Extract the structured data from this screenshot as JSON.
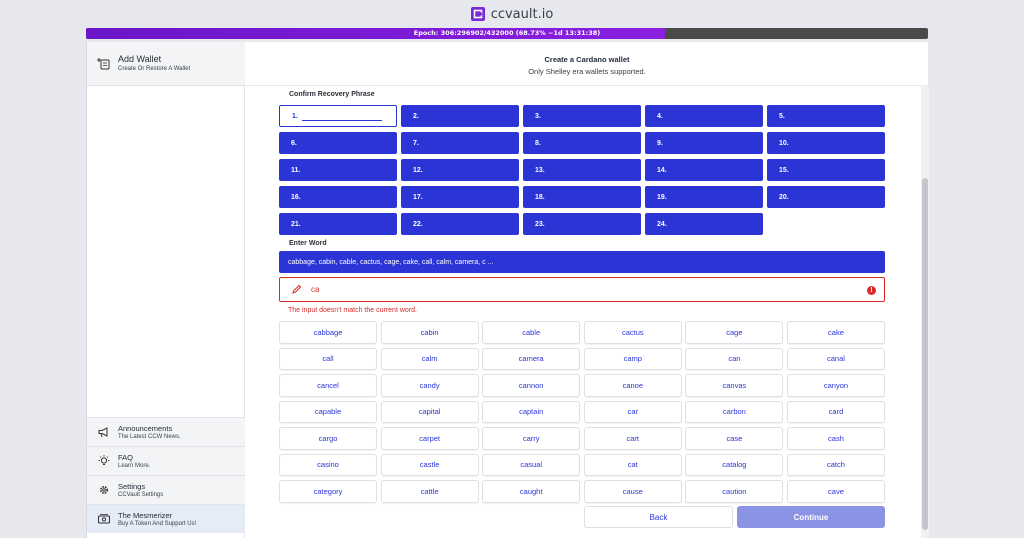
{
  "app": {
    "brand": "ccvault.io",
    "brand_color": "#7a2bd6"
  },
  "epoch": {
    "text": "Epoch: 306:296902/432000 (68.73% ~1d 13:31:38)",
    "progress": 0.6873
  },
  "sidebar": {
    "add_wallet": {
      "title": "Add Wallet",
      "subtitle": "Create Or Restore A Wallet",
      "icon": "add-wallet-icon"
    },
    "items": [
      {
        "title": "Announcements",
        "subtitle": "The Latest CCW News.",
        "icon": "megaphone-icon"
      },
      {
        "title": "FAQ",
        "subtitle": "Learn More.",
        "icon": "lightbulb-icon"
      },
      {
        "title": "Settings",
        "subtitle": "CCVault Settings",
        "icon": "gear-icon"
      },
      {
        "title": "The Mesmerizer",
        "subtitle": "Buy A Token And Support Us!",
        "icon": "money-icon"
      }
    ]
  },
  "header": {
    "title": "Create a Cardano wallet",
    "subtitle": "Only Shelley era wallets supported."
  },
  "recovery": {
    "label": "Confirm Recovery Phrase",
    "slots": [
      "1.",
      "2.",
      "3.",
      "4.",
      "5.",
      "6.",
      "7.",
      "8.",
      "9.",
      "10.",
      "11.",
      "12.",
      "13.",
      "14.",
      "15.",
      "16.",
      "17.",
      "18.",
      "19.",
      "20.",
      "21.",
      "22.",
      "23.",
      "24."
    ]
  },
  "enter_word": {
    "label": "Enter Word",
    "suggestions_text": "cabbage, cabin, cable, cactus, cage, cake, call, calm, camera, c ...",
    "input_value": "ca",
    "error": "The input doesn't match the current word."
  },
  "words": [
    "cabbage",
    "cabin",
    "cable",
    "cactus",
    "cage",
    "cake",
    "call",
    "calm",
    "camera",
    "camp",
    "can",
    "canal",
    "cancel",
    "candy",
    "cannon",
    "canoe",
    "canvas",
    "canyon",
    "capable",
    "capital",
    "captain",
    "car",
    "carbon",
    "card",
    "cargo",
    "carpet",
    "carry",
    "cart",
    "case",
    "cash",
    "casino",
    "castle",
    "casual",
    "cat",
    "catalog",
    "catch",
    "category",
    "cattle",
    "caught",
    "cause",
    "caution",
    "cave"
  ],
  "actions": {
    "back": "Back",
    "continue": "Continue"
  },
  "colors": {
    "primary": "#2b35d6",
    "error": "#d72a2a",
    "continue_disabled": "#8b93e5"
  }
}
